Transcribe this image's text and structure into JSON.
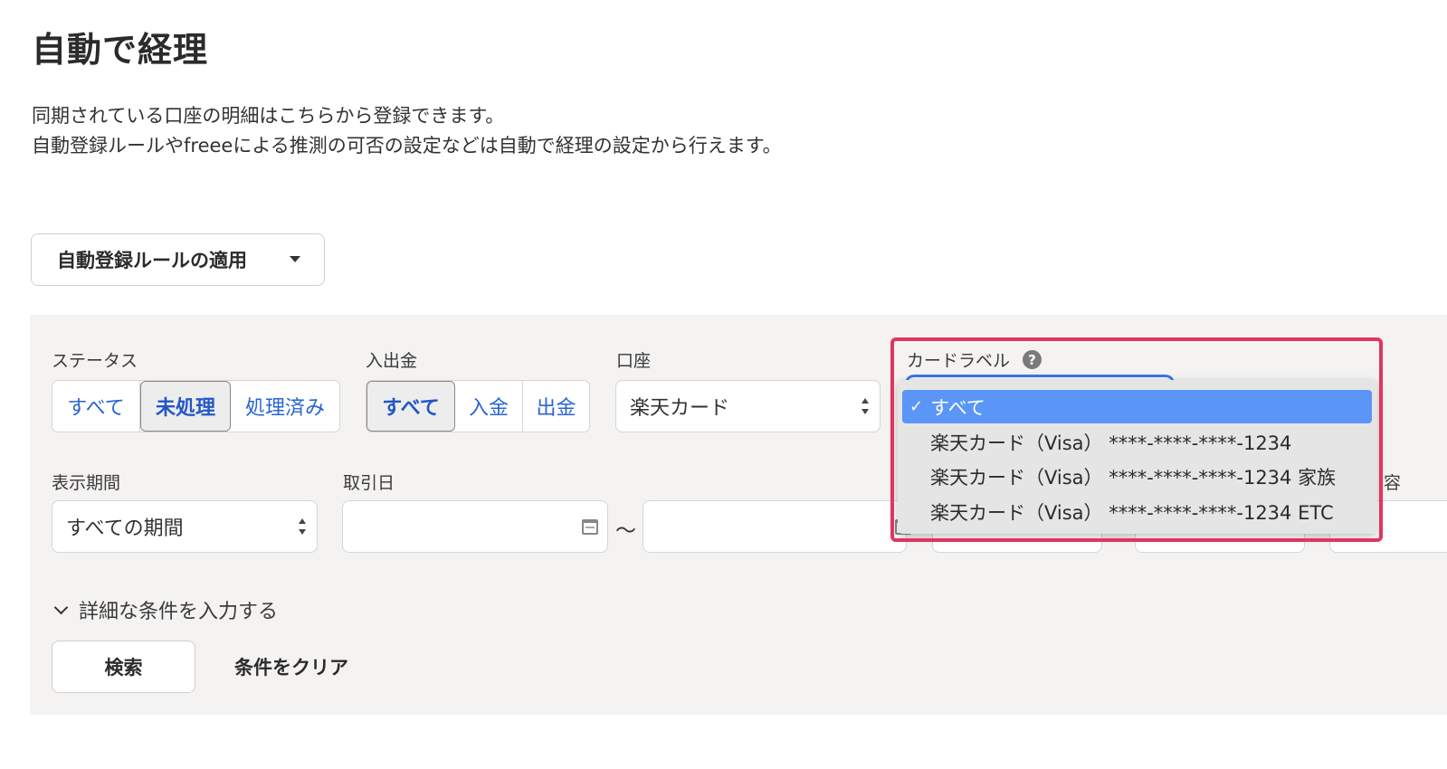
{
  "header": {
    "title": "自動で経理",
    "description_line1": "同期されている口座の明細はこちらから登録できます。",
    "description_line2": "自動登録ルールやfreeeによる推測の可否の設定などは自動で経理の設定から行えます。"
  },
  "rule_button": {
    "label": "自動登録ルールの適用"
  },
  "filters": {
    "status": {
      "label": "ステータス",
      "options": [
        "すべて",
        "未処理",
        "処理済み"
      ],
      "selected": "未処理"
    },
    "in_out": {
      "label": "入出金",
      "options": [
        "すべて",
        "入金",
        "出金"
      ],
      "selected": "すべて"
    },
    "account": {
      "label": "口座",
      "value": "楽天カード"
    },
    "card_label": {
      "label": "カードラベル",
      "help_icon": "?",
      "dropdown_options": [
        "すべて",
        "楽天カード（Visa） ****-****-****-1234",
        "楽天カード（Visa） ****-****-****-1234 家族",
        "楽天カード（Visa） ****-****-****-1234 ETC"
      ],
      "selected": "すべて",
      "check_mark": "✓"
    },
    "period": {
      "label": "表示期間",
      "value": "すべての期間"
    },
    "date": {
      "label": "取引日",
      "separator": "〜",
      "from_value": "",
      "to_value": ""
    },
    "partial_label": "容"
  },
  "actions": {
    "detail_toggle": "詳細な条件を入力する",
    "search": "検索",
    "clear": "条件をクリア"
  },
  "colors": {
    "link_blue": "#2864d3",
    "highlight": "#e0355f",
    "selected_option": "#5b96f7",
    "panel_bg": "#f4f3f2"
  }
}
